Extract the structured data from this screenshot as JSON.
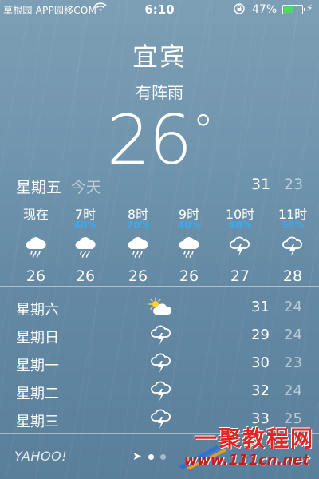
{
  "status": {
    "carrier": "草根园 APP园移COM",
    "time": "6:10",
    "battery_pct": "47%",
    "battery_level": 0.47,
    "icons": [
      "wifi-icon",
      "orientation-lock-icon",
      "battery-icon",
      "charging-icon"
    ]
  },
  "location": {
    "city": "宜宾",
    "condition": "有阵雨",
    "temperature": "26",
    "degree": "°"
  },
  "today": {
    "day": "星期五",
    "label": "今天",
    "high": "31",
    "low": "23"
  },
  "hourly": [
    {
      "time": "现在",
      "precip": "",
      "icon": "rain-cloud",
      "temp": "26"
    },
    {
      "time": "7时",
      "precip": "40%",
      "icon": "rain-cloud",
      "temp": "26"
    },
    {
      "time": "8时",
      "precip": "70%",
      "icon": "rain-cloud",
      "temp": "26"
    },
    {
      "time": "9时",
      "precip": "40%",
      "icon": "rain-cloud",
      "temp": "26"
    },
    {
      "time": "10时",
      "precip": "40%",
      "icon": "thunderstorm-cloud",
      "temp": "27"
    },
    {
      "time": "11时",
      "precip": "50%",
      "icon": "thunderstorm-cloud",
      "temp": "28"
    }
  ],
  "daily": [
    {
      "day": "星期六",
      "icon": "partly-sunny",
      "high": "31",
      "low": "24"
    },
    {
      "day": "星期日",
      "icon": "thunderstorm-cloud",
      "high": "29",
      "low": "24"
    },
    {
      "day": "星期一",
      "icon": "thunderstorm-cloud",
      "high": "30",
      "low": "23"
    },
    {
      "day": "星期二",
      "icon": "thunderstorm-cloud",
      "high": "32",
      "low": "24"
    },
    {
      "day": "星期三",
      "icon": "thunderstorm-cloud",
      "high": "33",
      "low": "25"
    }
  ],
  "footer": {
    "provider": "YAHOO!"
  },
  "watermark": {
    "line1": "一聚教程网",
    "line2": "www.111cn.net"
  },
  "colors": {
    "precip": "#3aa9f2",
    "battery": "#4cd964",
    "watermark": "#e42323"
  }
}
